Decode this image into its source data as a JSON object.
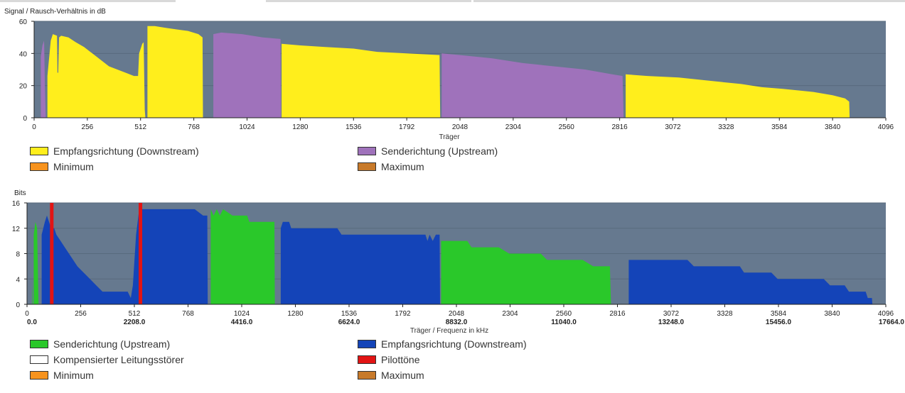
{
  "colors": {
    "plot_bg": "#66798f",
    "downstream_snr": "#ffee1c",
    "upstream_snr": "#9f72bb",
    "bits_upstream": "#2ac82a",
    "bits_downstream": "#1444b8",
    "pilot": "#e21414",
    "minimum": "#f7931e",
    "maximum": "#c87a2a",
    "noise": "#ffffff"
  },
  "chart_data": [
    {
      "type": "area",
      "ylabel": "Signal / Rausch-Verhältnis in dB",
      "xlabel": "Träger",
      "xlim": [
        0,
        4096
      ],
      "ylim": [
        0,
        60
      ],
      "yticks": [
        "0",
        "20",
        "40",
        "60"
      ],
      "xticks": [
        "0",
        "256",
        "512",
        "768",
        "1024",
        "1280",
        "1536",
        "1792",
        "2048",
        "2304",
        "2560",
        "2816",
        "3072",
        "3328",
        "3584",
        "3840",
        "4096"
      ],
      "series": [
        {
          "name": "Empfangsrichtung (Downstream)",
          "color_key": "downstream_snr",
          "segments": [
            [
              [
                64,
                0
              ],
              [
                64,
                26
              ],
              [
                80,
                48
              ],
              [
                90,
                52
              ],
              [
                110,
                51
              ],
              [
                112,
                28
              ],
              [
                116,
                28
              ],
              [
                120,
                50
              ],
              [
                130,
                51
              ],
              [
                165,
                50
              ],
              [
                200,
                47
              ],
              [
                240,
                44
              ],
              [
                280,
                40
              ],
              [
                320,
                36
              ],
              [
                360,
                32
              ],
              [
                400,
                30
              ],
              [
                440,
                28
              ],
              [
                480,
                26
              ],
              [
                500,
                26
              ],
              [
                505,
                40
              ],
              [
                520,
                46
              ],
              [
                527,
                47
              ],
              [
                532,
                5
              ],
              [
                535,
                0
              ]
            ],
            [
              [
                545,
                0
              ],
              [
                545,
                57
              ],
              [
                580,
                57
              ],
              [
                630,
                56
              ],
              [
                680,
                55
              ],
              [
                740,
                54
              ],
              [
                790,
                52
              ],
              [
                810,
                50
              ],
              [
                812,
                0
              ]
            ],
            [
              [
                1190,
                0
              ],
              [
                1190,
                46
              ],
              [
                1280,
                45
              ],
              [
                1400,
                44
              ],
              [
                1536,
                43
              ],
              [
                1650,
                41
              ],
              [
                1792,
                40
              ],
              [
                1950,
                39
              ],
              [
                1953,
                0
              ]
            ],
            [
              [
                2845,
                0
              ],
              [
                2845,
                27
              ],
              [
                2950,
                26
              ],
              [
                3100,
                25
              ],
              [
                3250,
                23
              ],
              [
                3400,
                21
              ],
              [
                3500,
                19
              ],
              [
                3600,
                18
              ],
              [
                3750,
                16
              ],
              [
                3840,
                14
              ],
              [
                3900,
                12
              ],
              [
                3920,
                10
              ],
              [
                3922,
                0
              ]
            ]
          ]
        },
        {
          "name": "Senderichtung (Upstream)",
          "color_key": "upstream_snr",
          "segments": [
            [
              [
                32,
                0
              ],
              [
                32,
                38
              ],
              [
                40,
                45
              ],
              [
                48,
                48
              ],
              [
                52,
                20
              ],
              [
                56,
                0
              ]
            ],
            [
              [
                862,
                0
              ],
              [
                862,
                52
              ],
              [
                900,
                53
              ],
              [
                1000,
                52
              ],
              [
                1100,
                50
              ],
              [
                1185,
                49
              ],
              [
                1187,
                0
              ]
            ],
            [
              [
                1960,
                0
              ],
              [
                1960,
                40
              ],
              [
                2048,
                39
              ],
              [
                2200,
                37
              ],
              [
                2350,
                34
              ],
              [
                2500,
                32
              ],
              [
                2650,
                30
              ],
              [
                2780,
                27
              ],
              [
                2830,
                26
              ],
              [
                2835,
                0
              ]
            ]
          ]
        },
        {
          "name": "Minimum",
          "color_key": "minimum",
          "segments": []
        },
        {
          "name": "Maximum",
          "color_key": "maximum",
          "segments": []
        }
      ]
    },
    {
      "type": "area",
      "ylabel": "Bits",
      "xlabel": "Träger / Frequenz in kHz",
      "xlim": [
        0,
        4096
      ],
      "ylim": [
        0,
        16
      ],
      "yticks": [
        "0",
        "4",
        "8",
        "12",
        "16"
      ],
      "xticks": [
        "0",
        "256",
        "512",
        "768",
        "1024",
        "1280",
        "1536",
        "1792",
        "2048",
        "2304",
        "2560",
        "2816",
        "3072",
        "3328",
        "3584",
        "3840",
        "4096"
      ],
      "freq_ticks": [
        {
          "x": 0,
          "label": "0.0"
        },
        {
          "x": 512,
          "label": "2208.0"
        },
        {
          "x": 1024,
          "label": "4416.0"
        },
        {
          "x": 1536,
          "label": "6624.0"
        },
        {
          "x": 2048,
          "label": "8832.0"
        },
        {
          "x": 2560,
          "label": "11040.0"
        },
        {
          "x": 3072,
          "label": "13248.0"
        },
        {
          "x": 3584,
          "label": "15456.0"
        },
        {
          "x": 4096,
          "label": "17664.0"
        }
      ],
      "series": [
        {
          "name": "Senderichtung (Upstream)",
          "color_key": "bits_upstream",
          "segments": [
            [
              [
                25,
                0
              ],
              [
                25,
                4
              ],
              [
                28,
                0
              ]
            ],
            [
              [
                32,
                0
              ],
              [
                32,
                11
              ],
              [
                40,
                13
              ],
              [
                48,
                12
              ],
              [
                55,
                0
              ]
            ],
            [
              [
                876,
                0
              ],
              [
                876,
                15
              ],
              [
                890,
                14
              ],
              [
                905,
                15
              ],
              [
                920,
                14
              ],
              [
                935,
                15
              ],
              [
                980,
                14
              ],
              [
                1050,
                14
              ],
              [
                1060,
                13
              ],
              [
                1180,
                13
              ],
              [
                1182,
                0
              ]
            ],
            [
              [
                1975,
                0
              ],
              [
                1975,
                10
              ],
              [
                2100,
                10
              ],
              [
                2120,
                9
              ],
              [
                2250,
                9
              ],
              [
                2300,
                8
              ],
              [
                2450,
                8
              ],
              [
                2480,
                7
              ],
              [
                2650,
                7
              ],
              [
                2700,
                6
              ],
              [
                2780,
                6
              ],
              [
                2785,
                0
              ]
            ]
          ]
        },
        {
          "name": "Empfangsrichtung (Downstream)",
          "color_key": "bits_downstream",
          "segments": [
            [
              [
                70,
                0
              ],
              [
                70,
                11
              ],
              [
                85,
                13
              ],
              [
                95,
                14
              ],
              [
                105,
                13
              ],
              [
                115,
                12
              ],
              [
                130,
                12
              ],
              [
                140,
                11
              ],
              [
                160,
                10
              ],
              [
                180,
                9
              ],
              [
                200,
                8
              ],
              [
                220,
                7
              ],
              [
                240,
                6
              ],
              [
                270,
                5
              ],
              [
                300,
                4
              ],
              [
                330,
                3
              ],
              [
                360,
                2
              ],
              [
                400,
                2
              ],
              [
                420,
                2
              ],
              [
                450,
                2
              ],
              [
                480,
                2
              ],
              [
                495,
                1
              ],
              [
                505,
                3
              ],
              [
                520,
                11
              ],
              [
                535,
                15
              ],
              [
                560,
                15
              ],
              [
                800,
                15
              ],
              [
                840,
                14
              ],
              [
                860,
                14
              ],
              [
                862,
                0
              ]
            ],
            [
              [
                1210,
                0
              ],
              [
                1210,
                12
              ],
              [
                1220,
                13
              ],
              [
                1250,
                13
              ],
              [
                1260,
                12
              ],
              [
                1480,
                12
              ],
              [
                1500,
                11
              ],
              [
                1900,
                11
              ],
              [
                1910,
                10
              ],
              [
                1920,
                11
              ],
              [
                1935,
                10
              ],
              [
                1950,
                11
              ],
              [
                1968,
                11
              ],
              [
                1970,
                0
              ]
            ],
            [
              [
                2870,
                0
              ],
              [
                2870,
                7
              ],
              [
                3150,
                7
              ],
              [
                3180,
                6
              ],
              [
                3400,
                6
              ],
              [
                3420,
                5
              ],
              [
                3550,
                5
              ],
              [
                3580,
                4
              ],
              [
                3800,
                4
              ],
              [
                3830,
                3
              ],
              [
                3900,
                3
              ],
              [
                3920,
                2
              ],
              [
                4000,
                2
              ],
              [
                4010,
                1
              ],
              [
                4030,
                1
              ],
              [
                4032,
                0
              ]
            ]
          ]
        },
        {
          "name": "Kompensierter Leitungsstörer",
          "color_key": "noise",
          "segments": []
        },
        {
          "name": "Pilottöne",
          "color_key": "pilot",
          "pilots": [
            118,
            541
          ]
        },
        {
          "name": "Minimum",
          "color_key": "minimum",
          "segments": []
        },
        {
          "name": "Maximum",
          "color_key": "maximum",
          "segments": []
        }
      ]
    }
  ]
}
